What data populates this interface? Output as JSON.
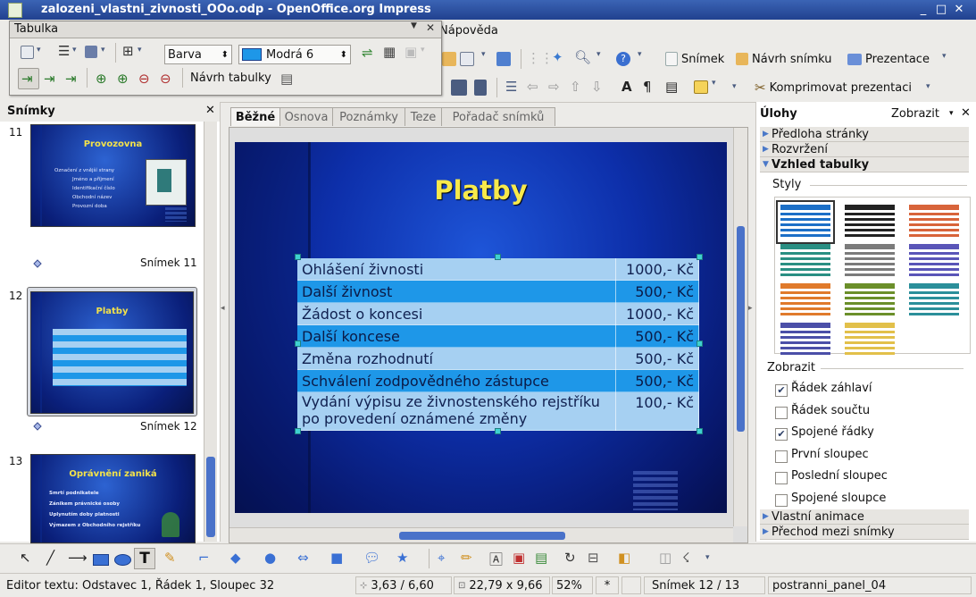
{
  "window": {
    "title": "zalozeni_vlastni_zivnosti_OOo.odp - OpenOffice.org Impress"
  },
  "menubar": {
    "visible_item": "Nápověda"
  },
  "toolbar1": {
    "snimek": "Snímek",
    "navrh_snimku": "Návrh snímku",
    "prezentace": "Prezentace"
  },
  "toolbar2": {
    "komprimovat": "Komprimovat prezentaci"
  },
  "tabulka_toolbar": {
    "title": "Tabulka",
    "fill_type": "Barva",
    "fill_color": "Modrá 6",
    "fill_color_hex": "#1e97e8",
    "navrh_tabulky": "Návrh tabulky"
  },
  "slides_panel": {
    "title": "Snímky",
    "slides": [
      {
        "number": "11",
        "label": "Snímek 11",
        "title": "Provozovna",
        "lines": [
          "Označení z vnější strany",
          "Jméno a příjmení",
          "Identifikační číslo",
          "Obchodní název",
          "Provozní doba"
        ]
      },
      {
        "number": "12",
        "label": "Snímek 12",
        "title": "Platby"
      },
      {
        "number": "13",
        "label": "",
        "title": "Oprávnění zaniká",
        "lines": [
          "Smrtí podnikatele",
          "Zánikem právnické osoby",
          "Uplynutím doby platnosti",
          "Výmazem z Obchodního rejstříku"
        ]
      }
    ]
  },
  "view_tabs": [
    {
      "label": "Běžné",
      "active": true
    },
    {
      "label": "Osnova",
      "active": false
    },
    {
      "label": "Poznámky",
      "active": false
    },
    {
      "label": "Teze",
      "active": false
    },
    {
      "label": "Pořadač snímků",
      "active": false
    }
  ],
  "slide": {
    "title": "Platby",
    "title_color": "#f7e94b",
    "rows": [
      {
        "item": "Ohlášení živnosti",
        "price": "1000,- Kč"
      },
      {
        "item": "Další živnost",
        "price": "500,- Kč"
      },
      {
        "item": "Žádost o koncesi",
        "price": "1000,- Kč"
      },
      {
        "item": "Další koncese",
        "price": "500,- Kč"
      },
      {
        "item": "Změna rozhodnutí",
        "price": "500,- Kč"
      },
      {
        "item": "Schválení zodpovědného zástupce",
        "price": "500,- Kč"
      },
      {
        "item": "Vydání výpisu ze živnostenského rejstříku po provedení oznámené změny",
        "price": "100,- Kč"
      }
    ]
  },
  "tasks_panel": {
    "title": "Úlohy",
    "view_menu": "Zobrazit",
    "sections": {
      "predloha": "Předloha stránky",
      "rozvrzeni": "Rozvržení",
      "vzhled": "Vzhled tabulky",
      "animace": "Vlastní animace",
      "prechod": "Přechod mezi snímky"
    },
    "styly_label": "Styly",
    "zobrazit_label": "Zobrazit",
    "options": [
      {
        "label": "Řádek záhlaví",
        "checked": true
      },
      {
        "label": "Řádek součtu",
        "checked": false
      },
      {
        "label": "Spojené řádky",
        "checked": true
      },
      {
        "label": "První sloupec",
        "checked": false
      },
      {
        "label": "Poslední sloupec",
        "checked": false
      },
      {
        "label": "Spojené sloupce",
        "checked": false
      }
    ],
    "style_colors": [
      "#1c6fc7",
      "#222222",
      "#d8643a",
      "#2a8f83",
      "#7b7b7b",
      "#5a55b8",
      "#e07a2b",
      "#6b8f2a",
      "#2b8f9a",
      "#4b4fa8",
      "#e2c04a"
    ]
  },
  "statusbar": {
    "mode": "Editor textu: Odstavec 1, Řádek 1, Sloupec 32",
    "position": "3,63 / 6,60",
    "size": "22,79 x 9,66",
    "zoom": "52%",
    "modified": "*",
    "slide": "Snímek 12 / 13",
    "master": "postranni_panel_04"
  }
}
